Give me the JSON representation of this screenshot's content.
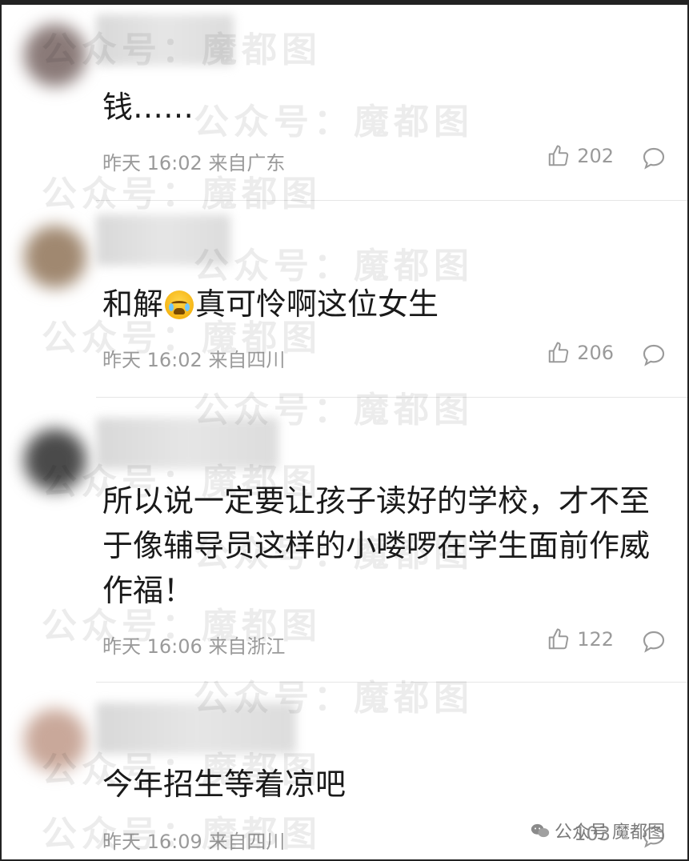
{
  "comments": [
    {
      "username": "",
      "text": "钱……",
      "time": "昨天 16:02",
      "location": "来自广东",
      "likes": "202",
      "avatar_color": "#8a7a78"
    },
    {
      "username": "",
      "text_before": "和解",
      "emoji": "crying-face-emoji",
      "text_after": "真可怜啊这位女生",
      "time": "昨天 16:02",
      "location": "来自四川",
      "likes": "206",
      "avatar_color": "#a08870"
    },
    {
      "username": "",
      "text": "所以说一定要让孩子读好的学校，才不至于像辅导员这样的小喽啰在学生面前作威作福！",
      "time": "昨天 16:06",
      "location": "来自浙江",
      "likes": "122",
      "avatar_color": "#4a4a4a"
    },
    {
      "username": "",
      "text": "今年招生等着凉吧",
      "time": "昨天 16:09",
      "location": "来自四川",
      "likes": "103",
      "avatar_color": "#c9a89a"
    }
  ],
  "watermark": {
    "text": "公众号：魔都图",
    "footer_text": "公众号",
    "footer_name": "魔都图",
    "icon": "wechat-icon"
  },
  "colors": {
    "meta_gray": "#9a9a9a",
    "text_dark": "#1a1a1a",
    "divider": "#e6e6e6"
  }
}
